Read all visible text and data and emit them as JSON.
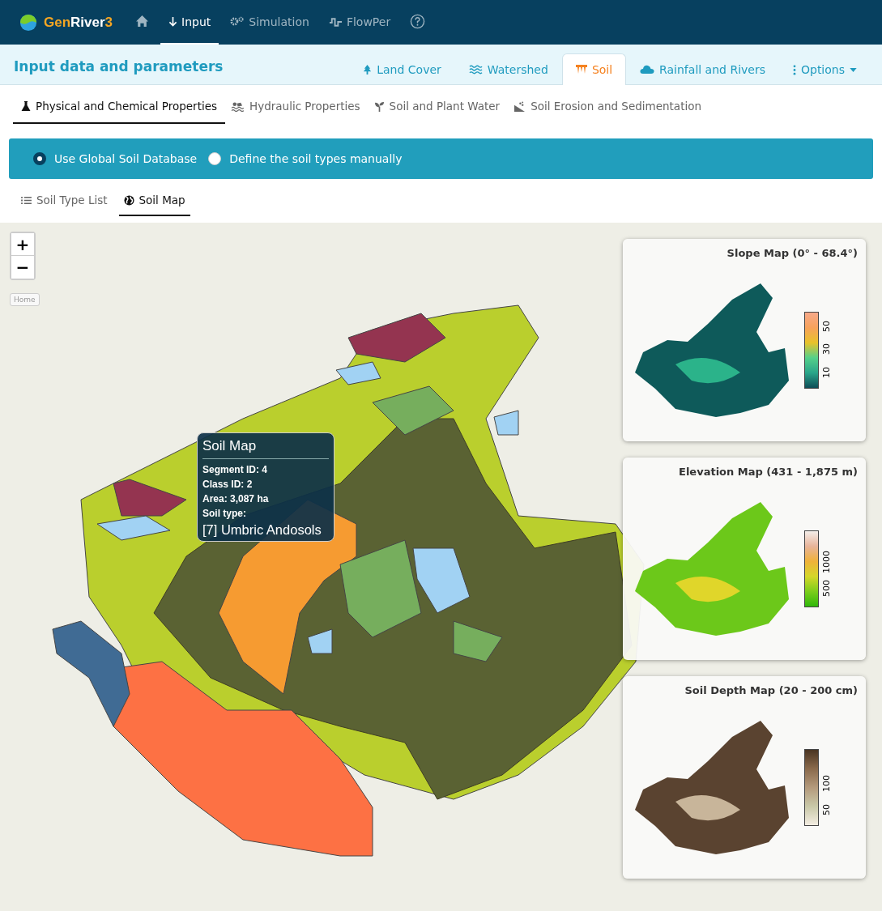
{
  "navbar": {
    "brand": [
      {
        "text": "Gen",
        "accent": true
      },
      {
        "text": "River",
        "accent": false
      },
      {
        "text": "3",
        "accent": true
      }
    ],
    "items": [
      {
        "kind": "home",
        "selected": false
      },
      {
        "kind": "input",
        "label": "Input",
        "selected": true
      },
      {
        "kind": "simulation",
        "label": "Simulation",
        "selected": false
      },
      {
        "kind": "flowper",
        "label": "FlowPer",
        "selected": false
      },
      {
        "kind": "help",
        "selected": false
      }
    ]
  },
  "header": {
    "title": "Input data and parameters",
    "tabs": [
      {
        "kind": "tree",
        "label": "Land Cover",
        "selected": false
      },
      {
        "kind": "waves",
        "label": "Watershed",
        "selected": false
      },
      {
        "kind": "soil",
        "label": "Soil",
        "selected": true
      },
      {
        "kind": "cloud",
        "label": "Rainfall and Rivers",
        "selected": false
      },
      {
        "kind": "dots",
        "label": "Options",
        "selected": false
      }
    ]
  },
  "subtabs": [
    {
      "kind": "flask",
      "label": "Physical and Chemical Properties",
      "selected": true
    },
    {
      "kind": "water",
      "label": "Hydraulic Properties",
      "selected": false
    },
    {
      "kind": "sprout",
      "label": "Soil and Plant Water",
      "selected": false
    },
    {
      "kind": "erosion",
      "label": "Soil Erosion and Sedimentation",
      "selected": false
    }
  ],
  "source_options": [
    {
      "label": "Use Global Soil Database",
      "selected": true
    },
    {
      "label": "Define the soil types manually",
      "selected": false
    }
  ],
  "view_tabs": [
    {
      "kind": "list",
      "label": "Soil Type List",
      "selected": false
    },
    {
      "kind": "globe",
      "label": "Soil Map",
      "selected": true
    }
  ],
  "map": {
    "zoom_controls": [
      "+",
      "−"
    ],
    "home_button": "Home",
    "tooltip": {
      "title": "Soil Map",
      "lines": [
        "Segment ID: 4",
        "Class ID: 2",
        "Area: 3,087 ha",
        "Soil type:"
      ],
      "soil_type": "[7] Umbric Andosols"
    },
    "insets": [
      {
        "kind": "slope",
        "title": "Slope Map (0° - 68.4°)",
        "ticks": [
          "10",
          "30",
          "50"
        ]
      },
      {
        "kind": "elevation",
        "title": "Elevation Map (431 - 1,875 m)",
        "ticks": [
          "500",
          "1000"
        ]
      },
      {
        "kind": "depth",
        "title": "Soil Depth Map (20 - 200 cm)",
        "ticks": [
          "50",
          "100"
        ]
      }
    ]
  }
}
